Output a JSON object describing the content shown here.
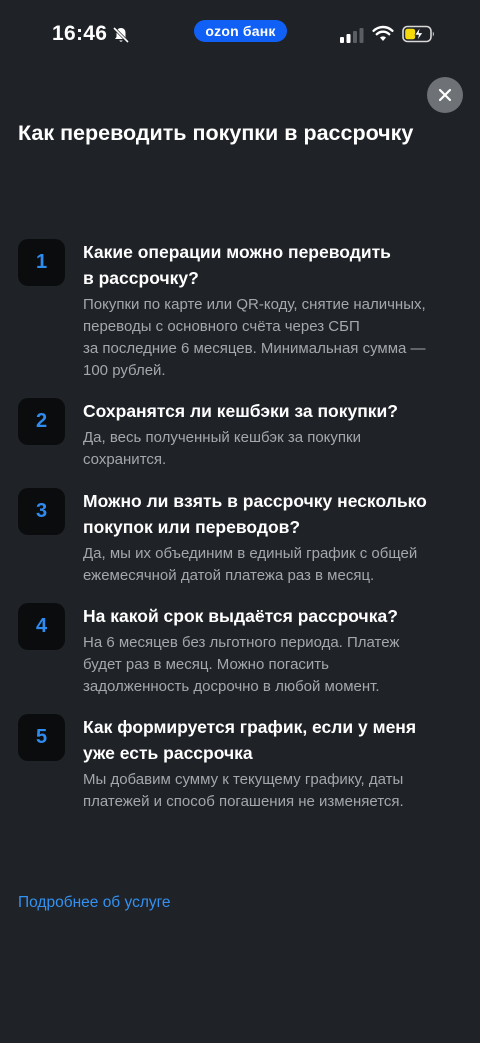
{
  "status_bar": {
    "time": "16:46",
    "carrier": "ozon банк",
    "icons": [
      "bell-off-icon",
      "signal-icon",
      "wifi-icon",
      "battery-charging-icon"
    ]
  },
  "colors": {
    "background": "#1f2226",
    "accent": "#1160f5",
    "number": "#2e8cf0",
    "link": "#3391f2",
    "secondary_text": "#a4a7ad"
  },
  "header": {
    "close_icon": "close-icon",
    "title": "Как переводить покупки в рассрочку"
  },
  "faq": [
    {
      "number": "1",
      "question_lines": [
        "Какие операции можно переводить",
        "в рассрочку?"
      ],
      "answer_lines": [
        "Покупки по карте или QR-коду, снятие наличных,",
        "переводы с основного счёта через СБП",
        "за последние 6 месяцев. Минимальная сумма —",
        "100 рублей."
      ]
    },
    {
      "number": "2",
      "question_lines": [
        "Сохранятся ли кешбэки за покупки?"
      ],
      "answer_lines": [
        "Да, весь полученный кешбэк за покупки",
        "сохранится."
      ]
    },
    {
      "number": "3",
      "question_lines": [
        "Можно ли взять в рассрочку несколько",
        "покупок или переводов?"
      ],
      "answer_lines": [
        "Да, мы их объединим в единый график с общей",
        "ежемесячной датой платежа раз в месяц."
      ]
    },
    {
      "number": "4",
      "question_lines": [
        "На какой срок выдаётся рассрочка?"
      ],
      "answer_lines": [
        "На 6 месяцев без льготного периода. Платеж",
        "будет раз в месяц. Можно погасить",
        "задолженность досрочно в любой момент."
      ]
    },
    {
      "number": "5",
      "question_lines": [
        "Как формируется график, если у меня",
        "уже есть рассрочка"
      ],
      "answer_lines": [
        "Мы добавим сумму к текущему графику, даты",
        "платежей и способ погашения не изменяется."
      ]
    }
  ],
  "footer": {
    "more_link": "Подробнее об услуге"
  }
}
